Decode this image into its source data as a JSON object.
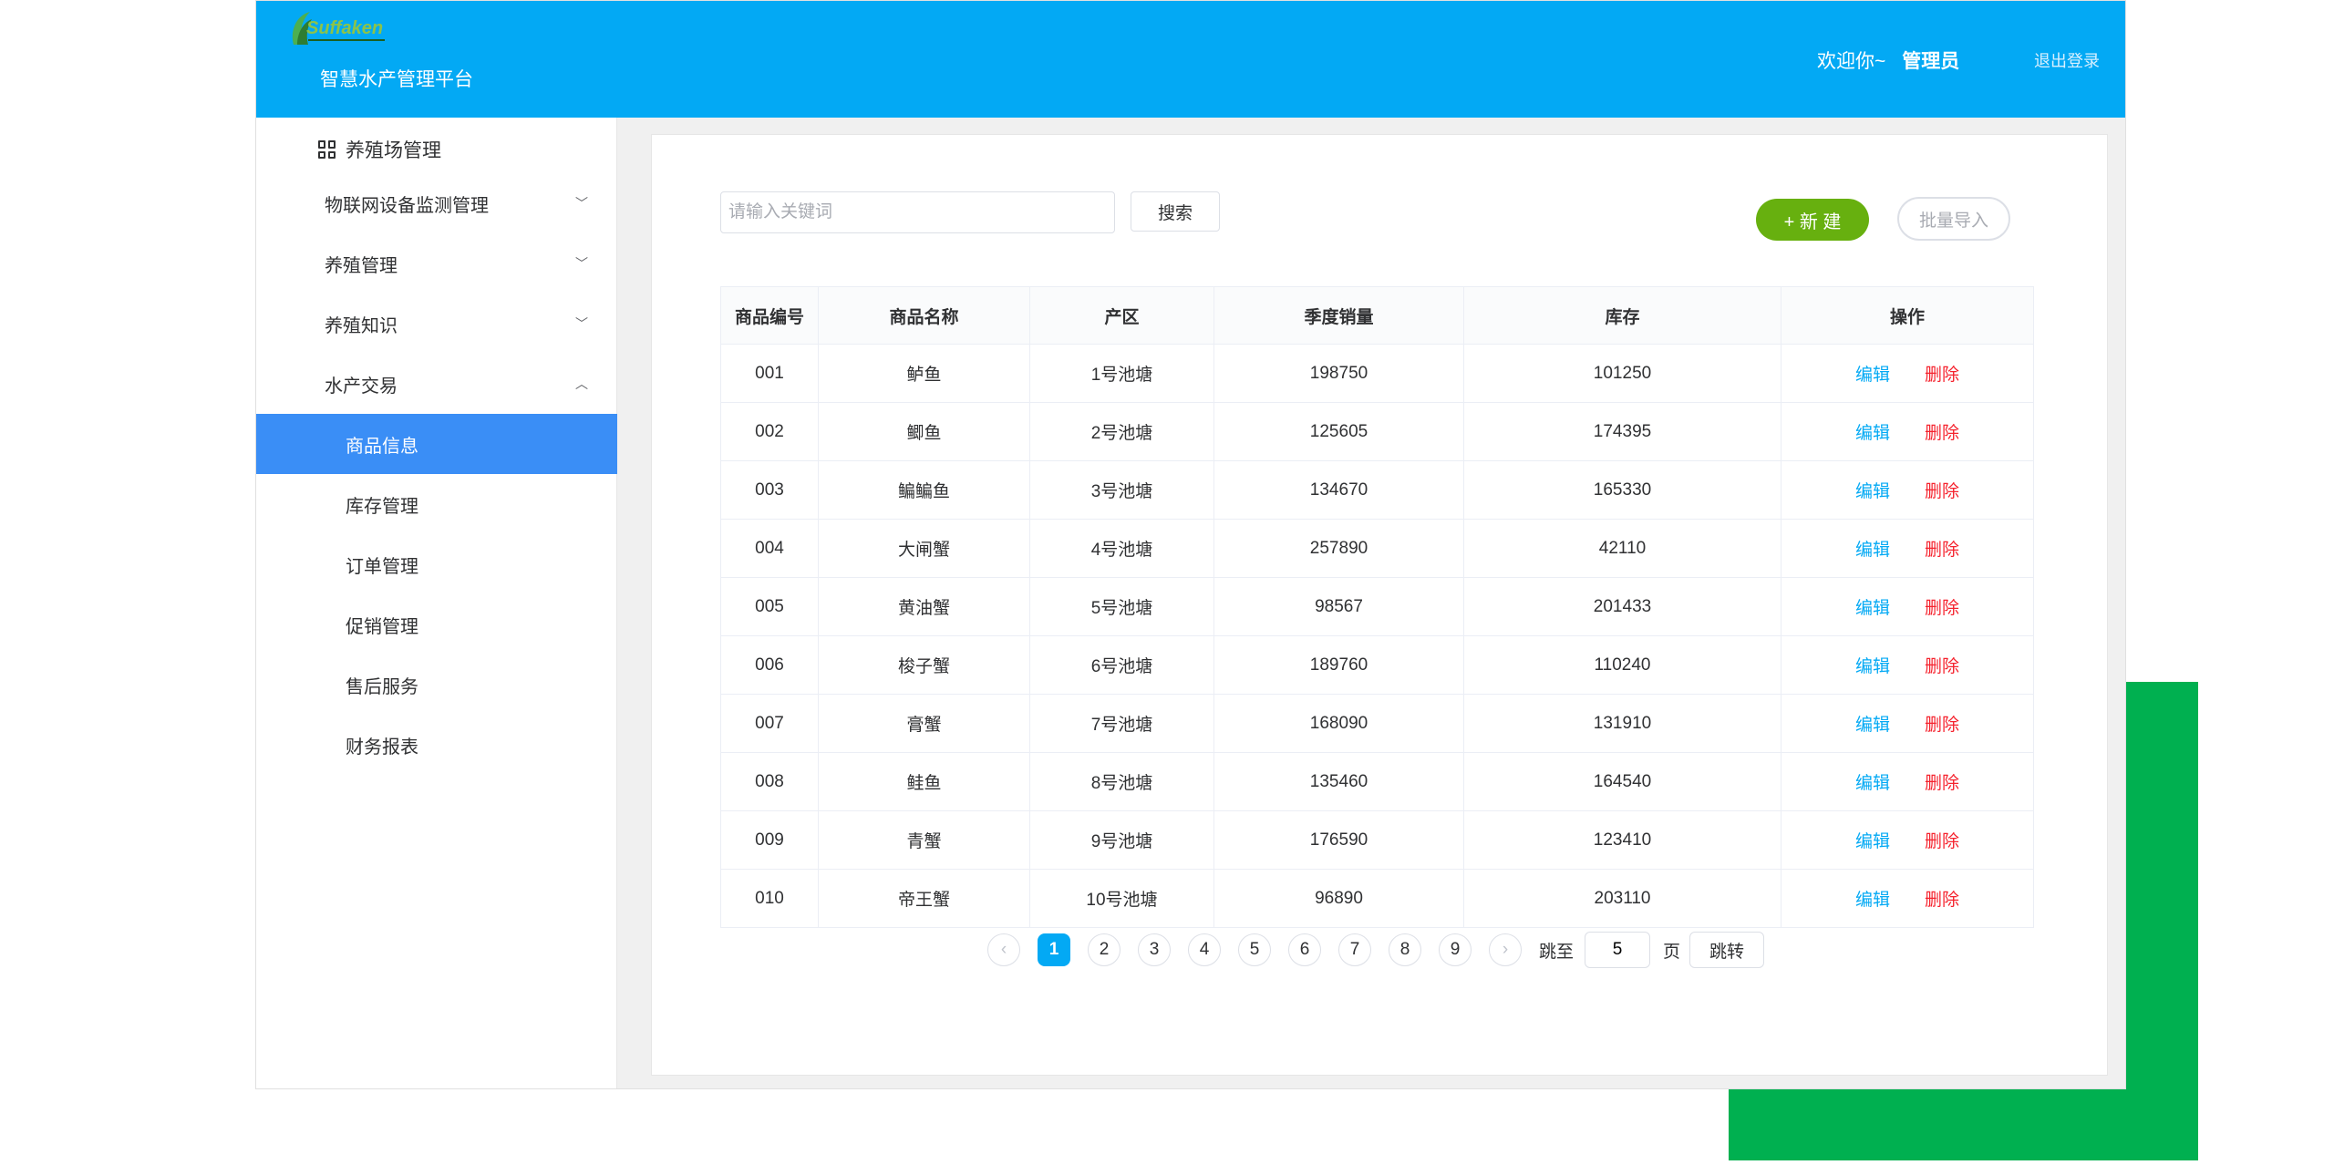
{
  "header": {
    "logo_text": "Suffaken",
    "platform_title": "智慧水产管理平台",
    "welcome": "欢迎你~",
    "user": "管理员",
    "logout": "退出登录"
  },
  "sidebar": {
    "top_label": "养殖场管理",
    "menus": [
      {
        "label": "物联网设备监测管理",
        "expanded": false
      },
      {
        "label": "养殖管理",
        "expanded": false
      },
      {
        "label": "养殖知识",
        "expanded": false
      },
      {
        "label": "水产交易",
        "expanded": true
      }
    ],
    "submenu": [
      {
        "label": "商品信息",
        "active": true
      },
      {
        "label": "库存管理"
      },
      {
        "label": "订单管理"
      },
      {
        "label": "促销管理"
      },
      {
        "label": "售后服务"
      },
      {
        "label": "财务报表"
      }
    ]
  },
  "toolbar": {
    "search_placeholder": "请输入关键词",
    "search_label": "搜索",
    "new_label": "+ 新 建",
    "import_label": "批量导入"
  },
  "table": {
    "columns": [
      "商品编号",
      "商品名称",
      "产区",
      "季度销量",
      "库存",
      "操作"
    ],
    "rows": [
      [
        "001",
        "鲈鱼",
        "1号池塘",
        "198750",
        "101250"
      ],
      [
        "002",
        "鲫鱼",
        "2号池塘",
        "125605",
        "174395"
      ],
      [
        "003",
        "鳊鳊鱼",
        "3号池塘",
        "134670",
        "165330"
      ],
      [
        "004",
        "大闸蟹",
        "4号池塘",
        "257890",
        "42110"
      ],
      [
        "005",
        "黄油蟹",
        "5号池塘",
        "98567",
        "201433"
      ],
      [
        "006",
        "梭子蟹",
        "6号池塘",
        "189760",
        "110240"
      ],
      [
        "007",
        "膏蟹",
        "7号池塘",
        "168090",
        "131910"
      ],
      [
        "008",
        "鲑鱼",
        "8号池塘",
        "135460",
        "164540"
      ],
      [
        "009",
        "青蟹",
        "9号池塘",
        "176590",
        "123410"
      ],
      [
        "010",
        "帝王蟹",
        "10号池塘",
        "96890",
        "203110"
      ]
    ],
    "action_edit": "编辑",
    "action_delete": "删除"
  },
  "pagination": {
    "pages": [
      "1",
      "2",
      "3",
      "4",
      "5",
      "6",
      "7",
      "8",
      "9"
    ],
    "current": "1",
    "prev_icon": "‹",
    "next_icon": "›",
    "jump_label": "跳至",
    "jump_value": "5",
    "page_unit": "页",
    "jump_button": "跳转"
  },
  "colors": {
    "header": "#03a9f4",
    "active_menu": "#3a8ef6",
    "new_button": "#67b00f",
    "edit": "#03a9f4",
    "delete": "#f5222d",
    "decoration": "#00b050"
  }
}
